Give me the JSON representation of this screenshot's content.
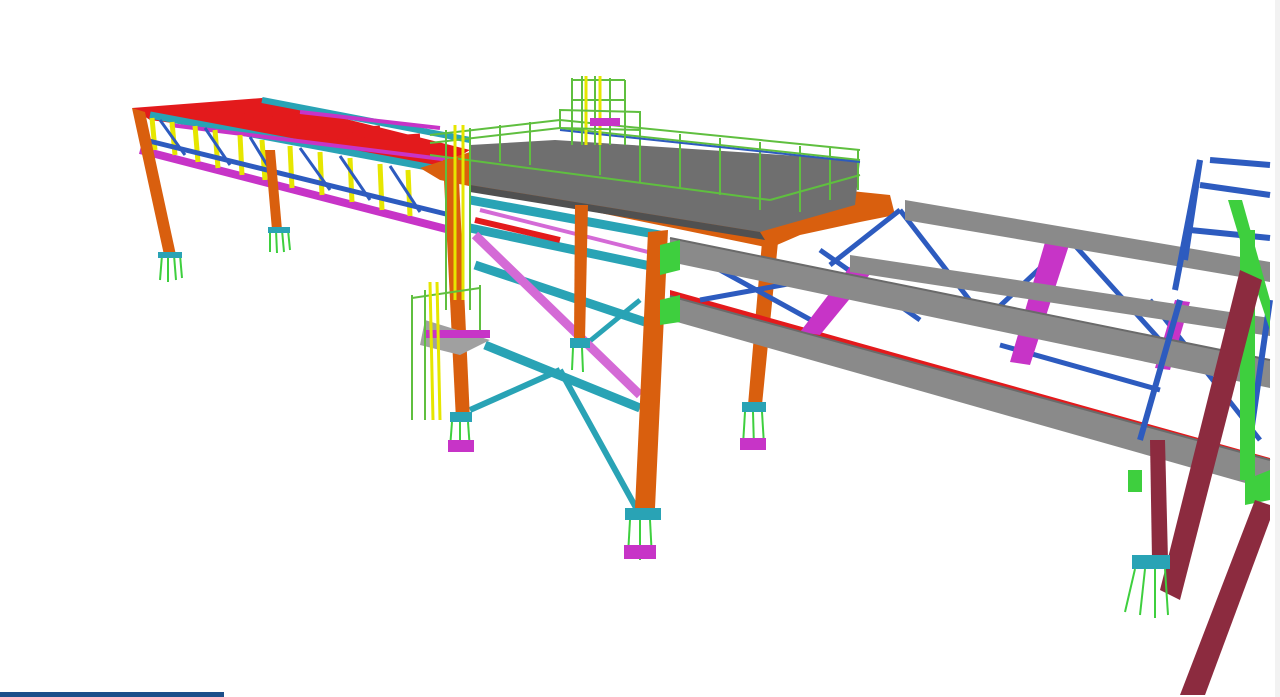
{
  "viewer": {
    "view": "3D model view",
    "background": "#ffffff"
  },
  "member_colors": {
    "columns": "#d95f0e",
    "main_beams": "#e31a1c",
    "secondary_beams": "#29a3b5",
    "bracing_blue": "#2d5bbf",
    "bracing_magenta": "#c734c7",
    "purlins_yellow": "#e6e600",
    "deck_gray": "#8a8a8a",
    "handrail_green": "#5fbf3f",
    "right_frame": "#8c2b3f",
    "gusset_green": "#3ecf3e"
  }
}
